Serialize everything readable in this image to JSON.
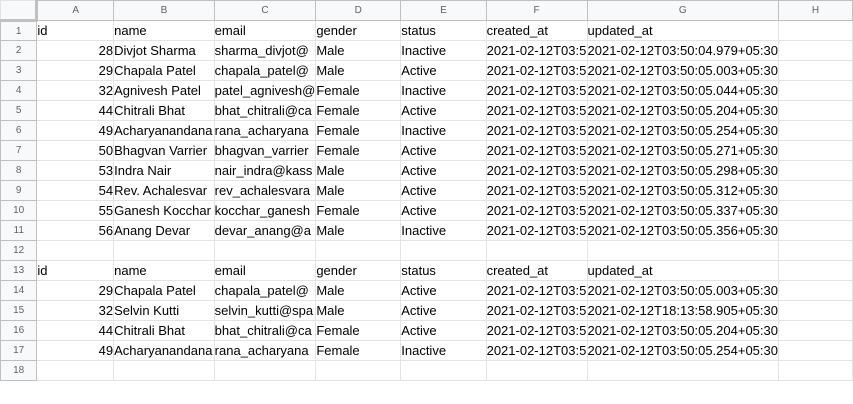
{
  "columns": [
    "A",
    "B",
    "C",
    "D",
    "E",
    "F",
    "G",
    "H"
  ],
  "rows": [
    {
      "num": "1",
      "cells": [
        "id",
        "name",
        "email",
        "gender",
        "status",
        "created_at",
        "updated_at",
        ""
      ]
    },
    {
      "num": "2",
      "cells": [
        "28",
        "Divjot Sharma",
        "sharma_divjot@",
        "Male",
        "Inactive",
        "2021-02-12T03:5",
        "2021-02-12T03:50:04.979+05:30",
        ""
      ]
    },
    {
      "num": "3",
      "cells": [
        "29",
        "Chapala Patel",
        "chapala_patel@",
        "Male",
        "Active",
        "2021-02-12T03:5",
        "2021-02-12T03:50:05.003+05:30",
        ""
      ]
    },
    {
      "num": "4",
      "cells": [
        "32",
        "Agnivesh Patel",
        "patel_agnivesh@",
        "Female",
        "Inactive",
        "2021-02-12T03:5",
        "2021-02-12T03:50:05.044+05:30",
        ""
      ]
    },
    {
      "num": "5",
      "cells": [
        "44",
        "Chitrali Bhat",
        "bhat_chitrali@ca",
        "Female",
        "Active",
        "2021-02-12T03:5",
        "2021-02-12T03:50:05.204+05:30",
        ""
      ]
    },
    {
      "num": "6",
      "cells": [
        "49",
        "Acharyanandana",
        "rana_acharyana",
        "Female",
        "Inactive",
        "2021-02-12T03:5",
        "2021-02-12T03:50:05.254+05:30",
        ""
      ]
    },
    {
      "num": "7",
      "cells": [
        "50",
        "Bhagvan Varrier",
        "bhagvan_varrier",
        "Female",
        "Active",
        "2021-02-12T03:5",
        "2021-02-12T03:50:05.271+05:30",
        ""
      ]
    },
    {
      "num": "8",
      "cells": [
        "53",
        "Indra Nair",
        "nair_indra@kass",
        "Male",
        "Active",
        "2021-02-12T03:5",
        "2021-02-12T03:50:05.298+05:30",
        ""
      ]
    },
    {
      "num": "9",
      "cells": [
        "54",
        "Rev. Achalesvar",
        "rev_achalesvara",
        "Male",
        "Active",
        "2021-02-12T03:5",
        "2021-02-12T03:50:05.312+05:30",
        ""
      ]
    },
    {
      "num": "10",
      "cells": [
        "55",
        "Ganesh Kocchar",
        "kocchar_ganesh",
        "Female",
        "Active",
        "2021-02-12T03:5",
        "2021-02-12T03:50:05.337+05:30",
        ""
      ]
    },
    {
      "num": "11",
      "cells": [
        "56",
        "Anang Devar",
        "devar_anang@a",
        "Male",
        "Inactive",
        "2021-02-12T03:5",
        "2021-02-12T03:50:05.356+05:30",
        ""
      ]
    },
    {
      "num": "12",
      "cells": [
        "",
        "",
        "",
        "",
        "",
        "",
        "",
        ""
      ]
    },
    {
      "num": "13",
      "cells": [
        "id",
        "name",
        "email",
        "gender",
        "status",
        "created_at",
        "updated_at",
        ""
      ]
    },
    {
      "num": "14",
      "cells": [
        "29",
        "Chapala Patel",
        "chapala_patel@",
        "Male",
        "Active",
        "2021-02-12T03:5",
        "2021-02-12T03:50:05.003+05:30",
        ""
      ]
    },
    {
      "num": "15",
      "cells": [
        "32",
        "Selvin Kutti",
        "selvin_kutti@spa",
        "Male",
        "Active",
        "2021-02-12T03:5",
        "2021-02-12T18:13:58.905+05:30",
        ""
      ]
    },
    {
      "num": "16",
      "cells": [
        "44",
        "Chitrali Bhat",
        "bhat_chitrali@ca",
        "Female",
        "Active",
        "2021-02-12T03:5",
        "2021-02-12T03:50:05.204+05:30",
        ""
      ]
    },
    {
      "num": "17",
      "cells": [
        "49",
        "Acharyanandana",
        "rana_acharyana",
        "Female",
        "Inactive",
        "2021-02-12T03:5",
        "2021-02-12T03:50:05.254+05:30",
        ""
      ]
    },
    {
      "num": "18",
      "cells": [
        "",
        "",
        "",
        "",
        "",
        "",
        "",
        ""
      ]
    }
  ]
}
